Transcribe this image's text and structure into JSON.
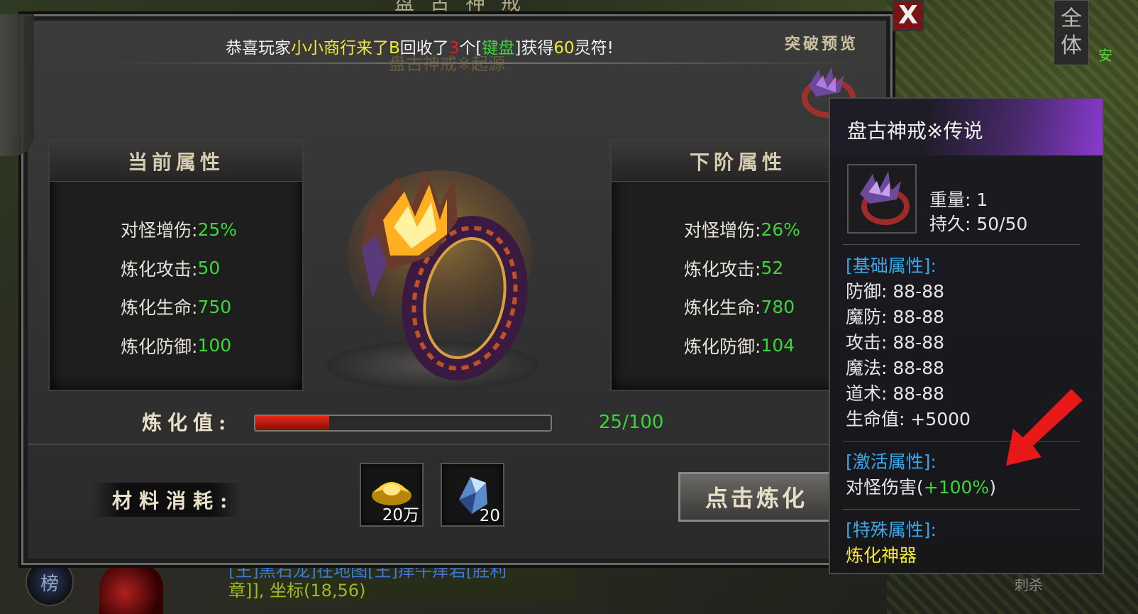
{
  "window": {
    "title": "盘古神戒",
    "close_label": "X"
  },
  "broadcast": {
    "prefix": "恭喜玩家",
    "player": "小小商行来了B",
    "action": "回收了",
    "count": "3",
    "unit": "个[",
    "item": "键盘",
    "suffix_a": "]获得",
    "reward": "60",
    "suffix_b": "灵符!"
  },
  "subtitle": "盘古神戒※起源",
  "preview_label": "突破预览",
  "current": {
    "title": "当前属性",
    "rows": [
      {
        "k": "对怪增伤:",
        "v": "25%"
      },
      {
        "k": "炼化攻击:",
        "v": "50"
      },
      {
        "k": "炼化生命:",
        "v": "750"
      },
      {
        "k": "炼化防御:",
        "v": "100"
      }
    ]
  },
  "next": {
    "title": "下阶属性",
    "rows": [
      {
        "k": "对怪增伤:",
        "v": "26%"
      },
      {
        "k": "炼化攻击:",
        "v": "52"
      },
      {
        "k": "炼化生命:",
        "v": "780"
      },
      {
        "k": "炼化防御:",
        "v": "104"
      }
    ]
  },
  "refine": {
    "label": "炼化值:",
    "value_text": "25/100",
    "progress": 0.25
  },
  "materials": {
    "label": "材料消耗:",
    "items": [
      {
        "name": "gold-ingot-icon",
        "qty": "20万"
      },
      {
        "name": "crystal-icon",
        "qty": "20"
      }
    ]
  },
  "refine_button": "点击炼化",
  "tooltip": {
    "name": "盘古神戒※传说",
    "weight": "重量: 1",
    "durability": "持久: 50/50",
    "base_title": "[基础属性]:",
    "base_rows": [
      "防御: 88-88",
      "魔防: 88-88",
      "攻击: 88-88",
      "魔法: 88-88",
      "道术: 88-88",
      "生命值: +5000"
    ],
    "active_title": "[激活属性]:",
    "active_prefix": "对怪伤害(",
    "active_value": "+100%",
    "active_suffix": ")",
    "special_title": "[特殊属性]:",
    "special_value": "炼化神器"
  },
  "side": {
    "btn_line1": "全",
    "btn_line2": "体",
    "green_text": "安"
  },
  "chat": {
    "line1": "[王]黑石龙]在地图[王]痒牛痒岩[胜利",
    "line2": "章]], 坐标(18,56)"
  },
  "bottom": {
    "rank_label": "榜",
    "skill_label": "刺杀"
  },
  "colors": {
    "accent_green": "#3cd63c",
    "accent_yellow": "#f2e93a",
    "accent_blue": "#3aa8e8",
    "bar_red": "#e02a1a"
  }
}
